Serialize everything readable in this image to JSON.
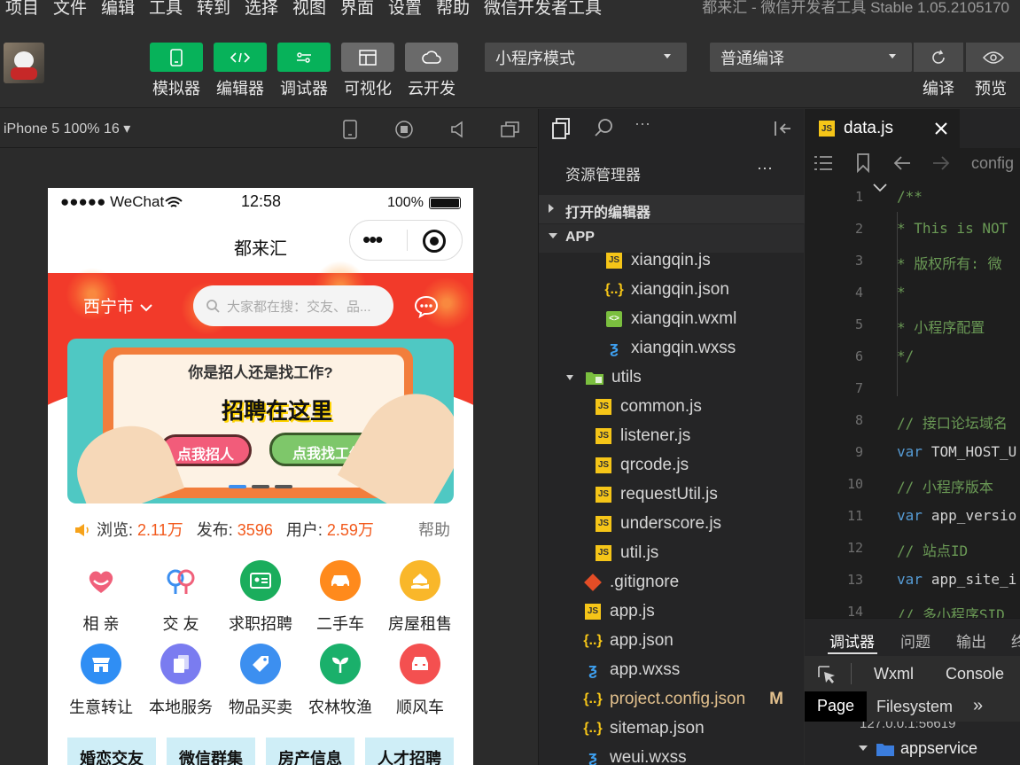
{
  "menubar": {
    "items": [
      "项目",
      "文件",
      "编辑",
      "工具",
      "转到",
      "选择",
      "视图",
      "界面",
      "设置",
      "帮助",
      "微信开发者工具"
    ],
    "window_title": "都来汇 - 微信开发者工具 Stable 1.05.2105170"
  },
  "toolbar": {
    "buttons": [
      {
        "label": "模拟器",
        "icon": "phone-icon"
      },
      {
        "label": "编辑器",
        "icon": "code-icon"
      },
      {
        "label": "调试器",
        "icon": "debug-icon"
      },
      {
        "label": "可视化",
        "icon": "layout-icon"
      },
      {
        "label": "云开发",
        "icon": "cloud-icon"
      }
    ],
    "mode_select": "小程序模式",
    "compile_select": "普通编译",
    "compile_label": "编译",
    "preview_label": "预览"
  },
  "simulator": {
    "device": "iPhone 5 100% 16 ▾"
  },
  "phone": {
    "status": {
      "carrier": "●●●●● WeChat",
      "time": "12:58",
      "battery": "100%"
    },
    "nav_title": "都来汇",
    "city": "西宁市",
    "search_placeholder": "大家都在搜：交友、品...",
    "banner": {
      "question": "你是招人还是找工作?",
      "headline": "招聘在这里",
      "btn_left": "点我招人",
      "btn_right": "点我找工作"
    },
    "stats": {
      "views_label": "浏览:",
      "views": "2.11万",
      "posts_label": "发布:",
      "posts": "3596",
      "users_label": "用户:",
      "users": "2.59万",
      "help": "帮助"
    },
    "categories": [
      {
        "label": "相 亲",
        "color": "#ffffff"
      },
      {
        "label": "交 友",
        "color": "#ffffff"
      },
      {
        "label": "求职招聘",
        "color": "#1aad5c"
      },
      {
        "label": "二手车",
        "color": "#ff8a1c"
      },
      {
        "label": "房屋租售",
        "color": "#f9b72a"
      },
      {
        "label": "生意转让",
        "color": "#2f8ef4"
      },
      {
        "label": "本地服务",
        "color": "#7a7cf0"
      },
      {
        "label": "物品买卖",
        "color": "#3c8ff0"
      },
      {
        "label": "农林牧渔",
        "color": "#1ab06b"
      },
      {
        "label": "顺风车",
        "color": "#f45050"
      }
    ],
    "tags": [
      "婚恋交友",
      "微信群集",
      "房产信息",
      "人才招聘"
    ]
  },
  "explorer": {
    "title": "资源管理器",
    "more": "···",
    "sections": {
      "open_editors": "打开的编辑器",
      "app": "APP"
    },
    "files": [
      {
        "name": "xiangqin.js",
        "type": "js",
        "indent": 1
      },
      {
        "name": "xiangqin.json",
        "type": "json",
        "indent": 1
      },
      {
        "name": "xiangqin.wxml",
        "type": "wxml",
        "indent": 1
      },
      {
        "name": "xiangqin.wxss",
        "type": "wxss",
        "indent": 1
      },
      {
        "name": "utils",
        "type": "folder",
        "indent": 0
      },
      {
        "name": "common.js",
        "type": "js",
        "indent": 1
      },
      {
        "name": "listener.js",
        "type": "js",
        "indent": 1
      },
      {
        "name": "qrcode.js",
        "type": "js",
        "indent": 1
      },
      {
        "name": "requestUtil.js",
        "type": "js",
        "indent": 1
      },
      {
        "name": "underscore.js",
        "type": "js",
        "indent": 1
      },
      {
        "name": "util.js",
        "type": "js",
        "indent": 1
      },
      {
        "name": ".gitignore",
        "type": "git",
        "indent": 0
      },
      {
        "name": "app.js",
        "type": "js",
        "indent": 0
      },
      {
        "name": "app.json",
        "type": "json",
        "indent": 0
      },
      {
        "name": "app.wxss",
        "type": "wxss",
        "indent": 0
      },
      {
        "name": "project.config.json",
        "type": "json",
        "indent": 0,
        "modified": "M"
      },
      {
        "name": "sitemap.json",
        "type": "json",
        "indent": 0
      },
      {
        "name": "weui.wxss",
        "type": "wxss",
        "indent": 0
      }
    ]
  },
  "editor": {
    "tab": "data.js",
    "breadcrumb": "config",
    "lines": [
      {
        "n": "1",
        "text": "/**",
        "cls": "cmt"
      },
      {
        "n": "2",
        "text": " * This is NOT",
        "cls": "cmt"
      },
      {
        "n": "3",
        "text": " * 版权所有: 微",
        "cls": "cmt"
      },
      {
        "n": "4",
        "text": " *",
        "cls": "cmt"
      },
      {
        "n": "5",
        "text": " * 小程序配置",
        "cls": "cmt"
      },
      {
        "n": "6",
        "text": " */",
        "cls": "cmt"
      },
      {
        "n": "7",
        "text": "",
        "cls": "cmt"
      },
      {
        "n": "8",
        "text": "// 接口论坛域名",
        "cls": "cmt"
      },
      {
        "n": "9",
        "kw": "var",
        "text": "TOM_HOST_U"
      },
      {
        "n": "10",
        "text": "// 小程序版本",
        "cls": "cmt"
      },
      {
        "n": "11",
        "kw": "var",
        "text": "app_versio"
      },
      {
        "n": "12",
        "text": "// 站点ID",
        "cls": "cmt"
      },
      {
        "n": "13",
        "kw": "var",
        "text": "app_site_i"
      },
      {
        "n": "14",
        "text": "// 多小程序SID",
        "cls": "cmt"
      }
    ]
  },
  "debugger": {
    "tabs": [
      "调试器",
      "问题",
      "输出",
      "终"
    ],
    "subtabs": [
      "Wxml",
      "Console"
    ],
    "subtabs2": [
      "Page",
      "Filesystem",
      "»"
    ],
    "tree": {
      "ip": "127.0.0.1:56619",
      "node": "appservice"
    }
  }
}
